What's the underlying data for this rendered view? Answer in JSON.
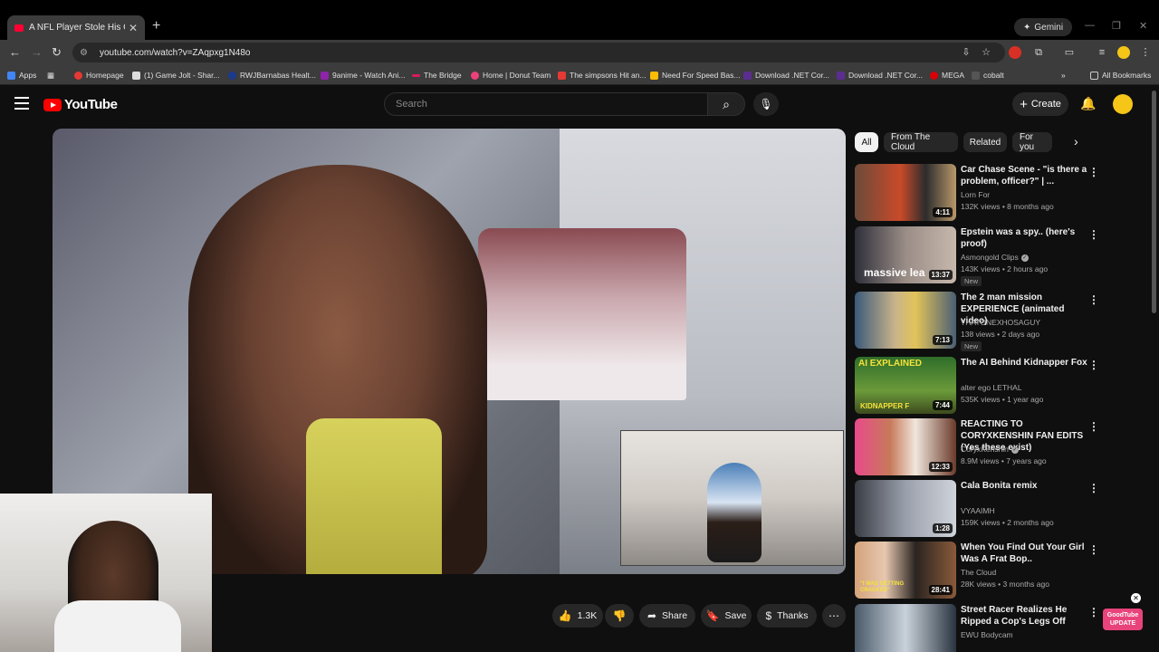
{
  "browser": {
    "tab_title": "A NFL Player Stole His Girl... - Yo",
    "gemini_label": "Gemini",
    "url": "youtube.com/watch?v=ZAqpxg1N48o",
    "bookmarks": [
      {
        "label": "Apps",
        "color": "#4285f4"
      },
      {
        "label": "Homepage",
        "color": "#e53935"
      },
      {
        "label": "(1) Game Jolt - Shar...",
        "color": "#ffffff"
      },
      {
        "label": "RWJBarnabas Healt...",
        "color": "#1a3a8f"
      },
      {
        "label": "9anime - Watch Ani...",
        "color": "#8e24aa"
      },
      {
        "label": "The Bridge",
        "color": "#d81b60"
      },
      {
        "label": "Home | Donut Team",
        "color": "#ec407a"
      },
      {
        "label": "The simpsons Hit an...",
        "color": "#e53935"
      },
      {
        "label": "Need For Speed Bas...",
        "color": "#fbbc04"
      },
      {
        "label": "Download .NET Cor...",
        "color": "#5c2d91"
      },
      {
        "label": "Download .NET Cor...",
        "color": "#5c2d91"
      },
      {
        "label": "MEGA",
        "color": "#d90007"
      },
      {
        "label": "cobalt",
        "color": "#222222"
      }
    ],
    "all_bookmarks": "All Bookmarks"
  },
  "youtube": {
    "logo_text": "YouTube",
    "search_placeholder": "Search",
    "create_label": "Create"
  },
  "actions": {
    "likes": "1.3K",
    "share": "Share",
    "save": "Save",
    "thanks": "Thanks"
  },
  "chips": [
    "All",
    "From The Cloud",
    "Related",
    "For you"
  ],
  "recommendations": [
    {
      "title": "Car Chase Scene - \"is there a problem, officer?\" | ...",
      "channel": "Lorn For",
      "meta": "132K views • 8 months ago",
      "duration": "4:11",
      "verified": false,
      "badge": ""
    },
    {
      "title": "Epstein was a spy.. (here's proof)",
      "channel": "Asmongold Clips",
      "meta": "143K views • 2 hours ago",
      "duration": "13:37",
      "verified": true,
      "badge": "New"
    },
    {
      "title": "The 2 man mission EXPERIENCE (animated video)",
      "channel": "THATONEXHOSAGUY",
      "meta": "138 views • 2 days ago",
      "duration": "7:13",
      "verified": false,
      "badge": "New"
    },
    {
      "title": "The AI Behind Kidnapper Fox",
      "channel": "alter ego LETHAL",
      "meta": "535K views • 1 year ago",
      "duration": "7:44",
      "verified": false,
      "badge": ""
    },
    {
      "title": "REACTING TO CORYXKENSHIN FAN EDITS (Yes these exist)",
      "channel": "CoryxKenshin",
      "meta": "8.9M views • 7 years ago",
      "duration": "12:33",
      "verified": true,
      "badge": ""
    },
    {
      "title": "Cala Bonita remix",
      "channel": "VYAAIMH",
      "meta": "159K views • 2 months ago",
      "duration": "1:28",
      "verified": false,
      "badge": ""
    },
    {
      "title": "When You Find Out Your Girl Was A Frat Bop..",
      "channel": "The Cloud",
      "meta": "28K views • 3 months ago",
      "duration": "28:41",
      "verified": false,
      "badge": ""
    },
    {
      "title": "Street Racer Realizes He Ripped a Cop's Legs Off",
      "channel": "EWU Bodycam",
      "meta": "",
      "duration": "",
      "verified": false,
      "badge": ""
    }
  ],
  "thumbnail_text": {
    "epstein": "massive lea",
    "ai": "AI EXPLAINED",
    "ai_sub": "KIDNAPPER F",
    "frat": "\"I WAS GETTING CRACKED\""
  },
  "extension_badge": "GoodTube UPDATE",
  "colors": {
    "accent": "#ff0000",
    "bg": "#0f0f0f",
    "chip_bg": "#272727"
  }
}
